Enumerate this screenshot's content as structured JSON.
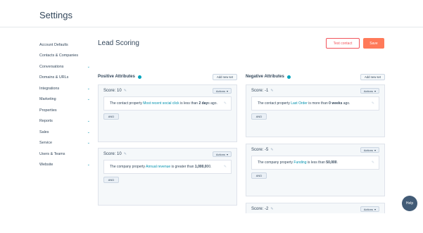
{
  "header": {
    "title": "Settings"
  },
  "sidebar": {
    "items": [
      {
        "label": "Account Defaults",
        "chevron": false
      },
      {
        "label": "Contacts & Companies",
        "chevron": false
      },
      {
        "label": "Conversations",
        "chevron": true
      },
      {
        "label": "Domains & URLs",
        "chevron": false
      },
      {
        "label": "Integrations",
        "chevron": true
      },
      {
        "label": "Marketing",
        "chevron": true
      },
      {
        "label": "Properties",
        "chevron": false
      },
      {
        "label": "Reports",
        "chevron": true
      },
      {
        "label": "Sales",
        "chevron": true
      },
      {
        "label": "Service",
        "chevron": true
      },
      {
        "label": "Users & Teams",
        "chevron": false
      },
      {
        "label": "Website",
        "chevron": true
      }
    ]
  },
  "main": {
    "title": "Lead Scoring",
    "test_contact_label": "Test contact",
    "save_label": "Save",
    "positive": {
      "title": "Positive Attributes",
      "add_set_label": "Add new set",
      "cards": [
        {
          "score": "Score: 10",
          "actions": "Actions",
          "pre": "The contact property ",
          "prop": "Most recent social click",
          "mid": " is less than ",
          "val": "2 day",
          "post": "s ago.",
          "and": "AND"
        },
        {
          "score": "Score: 10",
          "actions": "Actions",
          "pre": "The company property ",
          "prop": "Annual revenue",
          "mid": " is greater than ",
          "val": "1,000,0",
          "post": "00.",
          "and": "AND"
        }
      ]
    },
    "negative": {
      "title": "Negative Attributes",
      "add_set_label": "Add new set",
      "cards": [
        {
          "score": "Score: -1",
          "actions": "Actions",
          "pre": "The contact property ",
          "prop": "Last Order",
          "mid": " is more than ",
          "val": "0 weeks",
          "post": " ago.",
          "and": "AND"
        },
        {
          "score": "Score: -5",
          "actions": "Actions",
          "pre": "The company property ",
          "prop": "Funding",
          "mid": " is less than ",
          "val": "50,000",
          "post": ".",
          "and": "AND"
        },
        {
          "score": "Score: -2",
          "actions": "Actions"
        }
      ]
    }
  },
  "help": {
    "label": "Help"
  }
}
